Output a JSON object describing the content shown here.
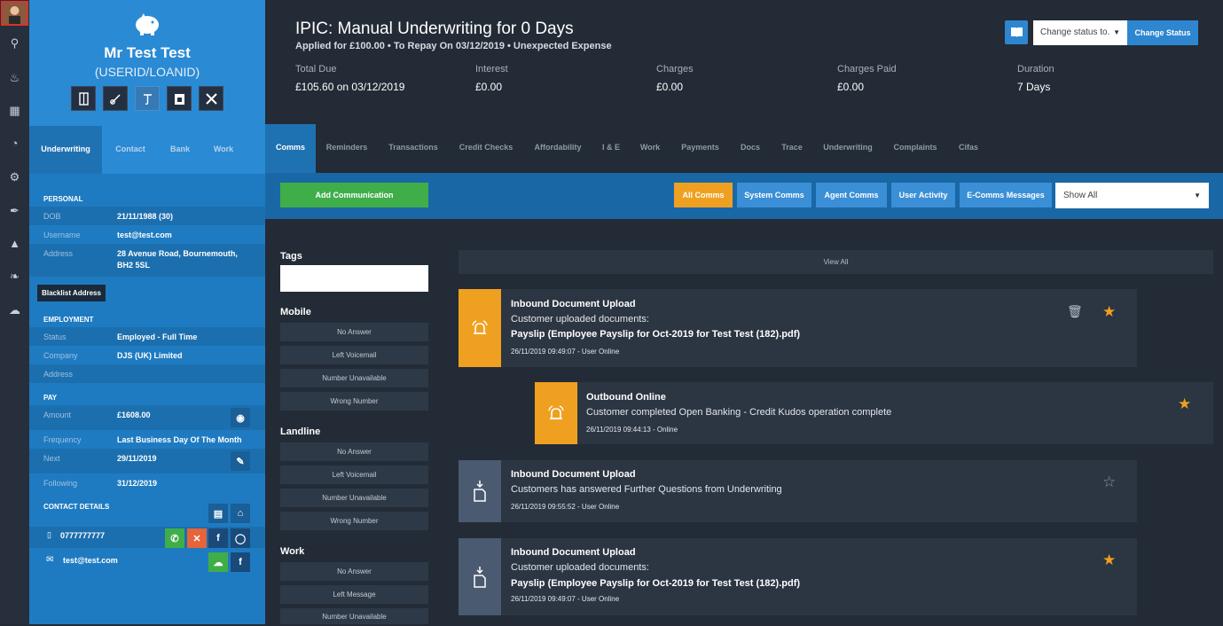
{
  "sidebar_rail": {
    "icons": [
      "avatar",
      "search-icon",
      "bell-icon",
      "report-icon",
      "pie-chart-icon",
      "settings-icon",
      "guitar-icon",
      "megaphone-icon",
      "leaf-icon",
      "cloud-icon"
    ]
  },
  "customer": {
    "name": "Mr Test Test",
    "id": "(USERID/LOANID)",
    "tabs": [
      "Underwriting",
      "Contact",
      "Bank",
      "Work"
    ],
    "personal_heading": "PERSONAL",
    "dob_label": "DOB",
    "dob": "21/11/1988 (30)",
    "username_label": "Username",
    "username": "test@test.com",
    "address_label": "Address",
    "address": "28 Avenue Road, Bournemouth, BH2 5SL",
    "blacklist": "Blacklist Address",
    "employment_heading": "EMPLOYMENT",
    "status_label": "Status",
    "status": "Employed - Full Time",
    "company_label": "Company",
    "company": "DJS (UK) Limited",
    "emp_address_label": "Address",
    "pay_heading": "PAY",
    "amount_label": "Amount",
    "amount": "£1608.00",
    "frequency_label": "Frequency",
    "frequency": "Last Business Day Of The Month",
    "next_label": "Next",
    "next": "29/11/2019",
    "following_label": "Following",
    "following": "31/12/2019",
    "contact_heading": "CONTACT DETAILS",
    "phone": "0777777777",
    "email": "test@test.com",
    "facebook": "f"
  },
  "header": {
    "title": "IPIC: Manual Underwriting for 0 Days",
    "subtitle": "Applied for £100.00 • To Repay On 03/12/2019 • Unexpected Expense",
    "status_select": "Change status to.",
    "status_button": "Change Status",
    "stats": [
      {
        "label": "Total Due",
        "value": "£105.60 on 03/12/2019"
      },
      {
        "label": "Interest",
        "value": "£0.00"
      },
      {
        "label": "Charges",
        "value": "£0.00"
      },
      {
        "label": "Charges Paid",
        "value": "£0.00"
      },
      {
        "label": "Duration",
        "value": "7 Days"
      }
    ]
  },
  "tabs": [
    "Comms",
    "Reminders",
    "Transactions",
    "Credit Checks",
    "Affordability",
    "I & E",
    "Work",
    "Payments",
    "Docs",
    "Trace",
    "Underwriting",
    "Complaints",
    "Cifas"
  ],
  "toolbar": {
    "add": "Add Communication",
    "filters": [
      "All Comms",
      "System Comms",
      "Agent Comms",
      "User Activity",
      "E-Comms Messages"
    ],
    "show": "Show All"
  },
  "left_panel": {
    "tags": "Tags",
    "mobile": "Mobile",
    "mobile_opts": [
      "No Answer",
      "Left Voicemail",
      "Number Unavailable",
      "Wrong Number"
    ],
    "landline": "Landline",
    "landline_opts": [
      "No Answer",
      "Left Voicemail",
      "Number Unavailable",
      "Wrong Number"
    ],
    "work": "Work",
    "work_opts": [
      "No Answer",
      "Left Message",
      "Number Unavailable"
    ]
  },
  "view_all": "View All",
  "comms": [
    {
      "title": "Inbound Document Upload",
      "line1": "Customer uploaded documents:",
      "line2": "Payslip (Employee Payslip for Oct-2019 for Test Test (182).pdf)",
      "meta": "26/11/2019 09:49:07 - User Online"
    },
    {
      "title": "Outbound Online",
      "line1": "Customer completed Open Banking - Credit Kudos operation complete",
      "meta": "26/11/2019 09:44:13 - Online"
    },
    {
      "title": "Inbound Document Upload",
      "line1": "Customers has answered Further Questions from Underwriting",
      "meta": "26/11/2019 09:55:52 - User Online"
    },
    {
      "title": "Inbound Document Upload",
      "line1": "Customer uploaded documents:",
      "line2": "Payslip (Employee Payslip for Oct-2019 for Test Test (182).pdf)",
      "meta": "26/11/2019 09:49:07 - User Online"
    }
  ],
  "colors": {
    "accent": "#1f7bc1",
    "orange": "#f0a020",
    "green": "#3fae49",
    "red": "#e7633a"
  }
}
